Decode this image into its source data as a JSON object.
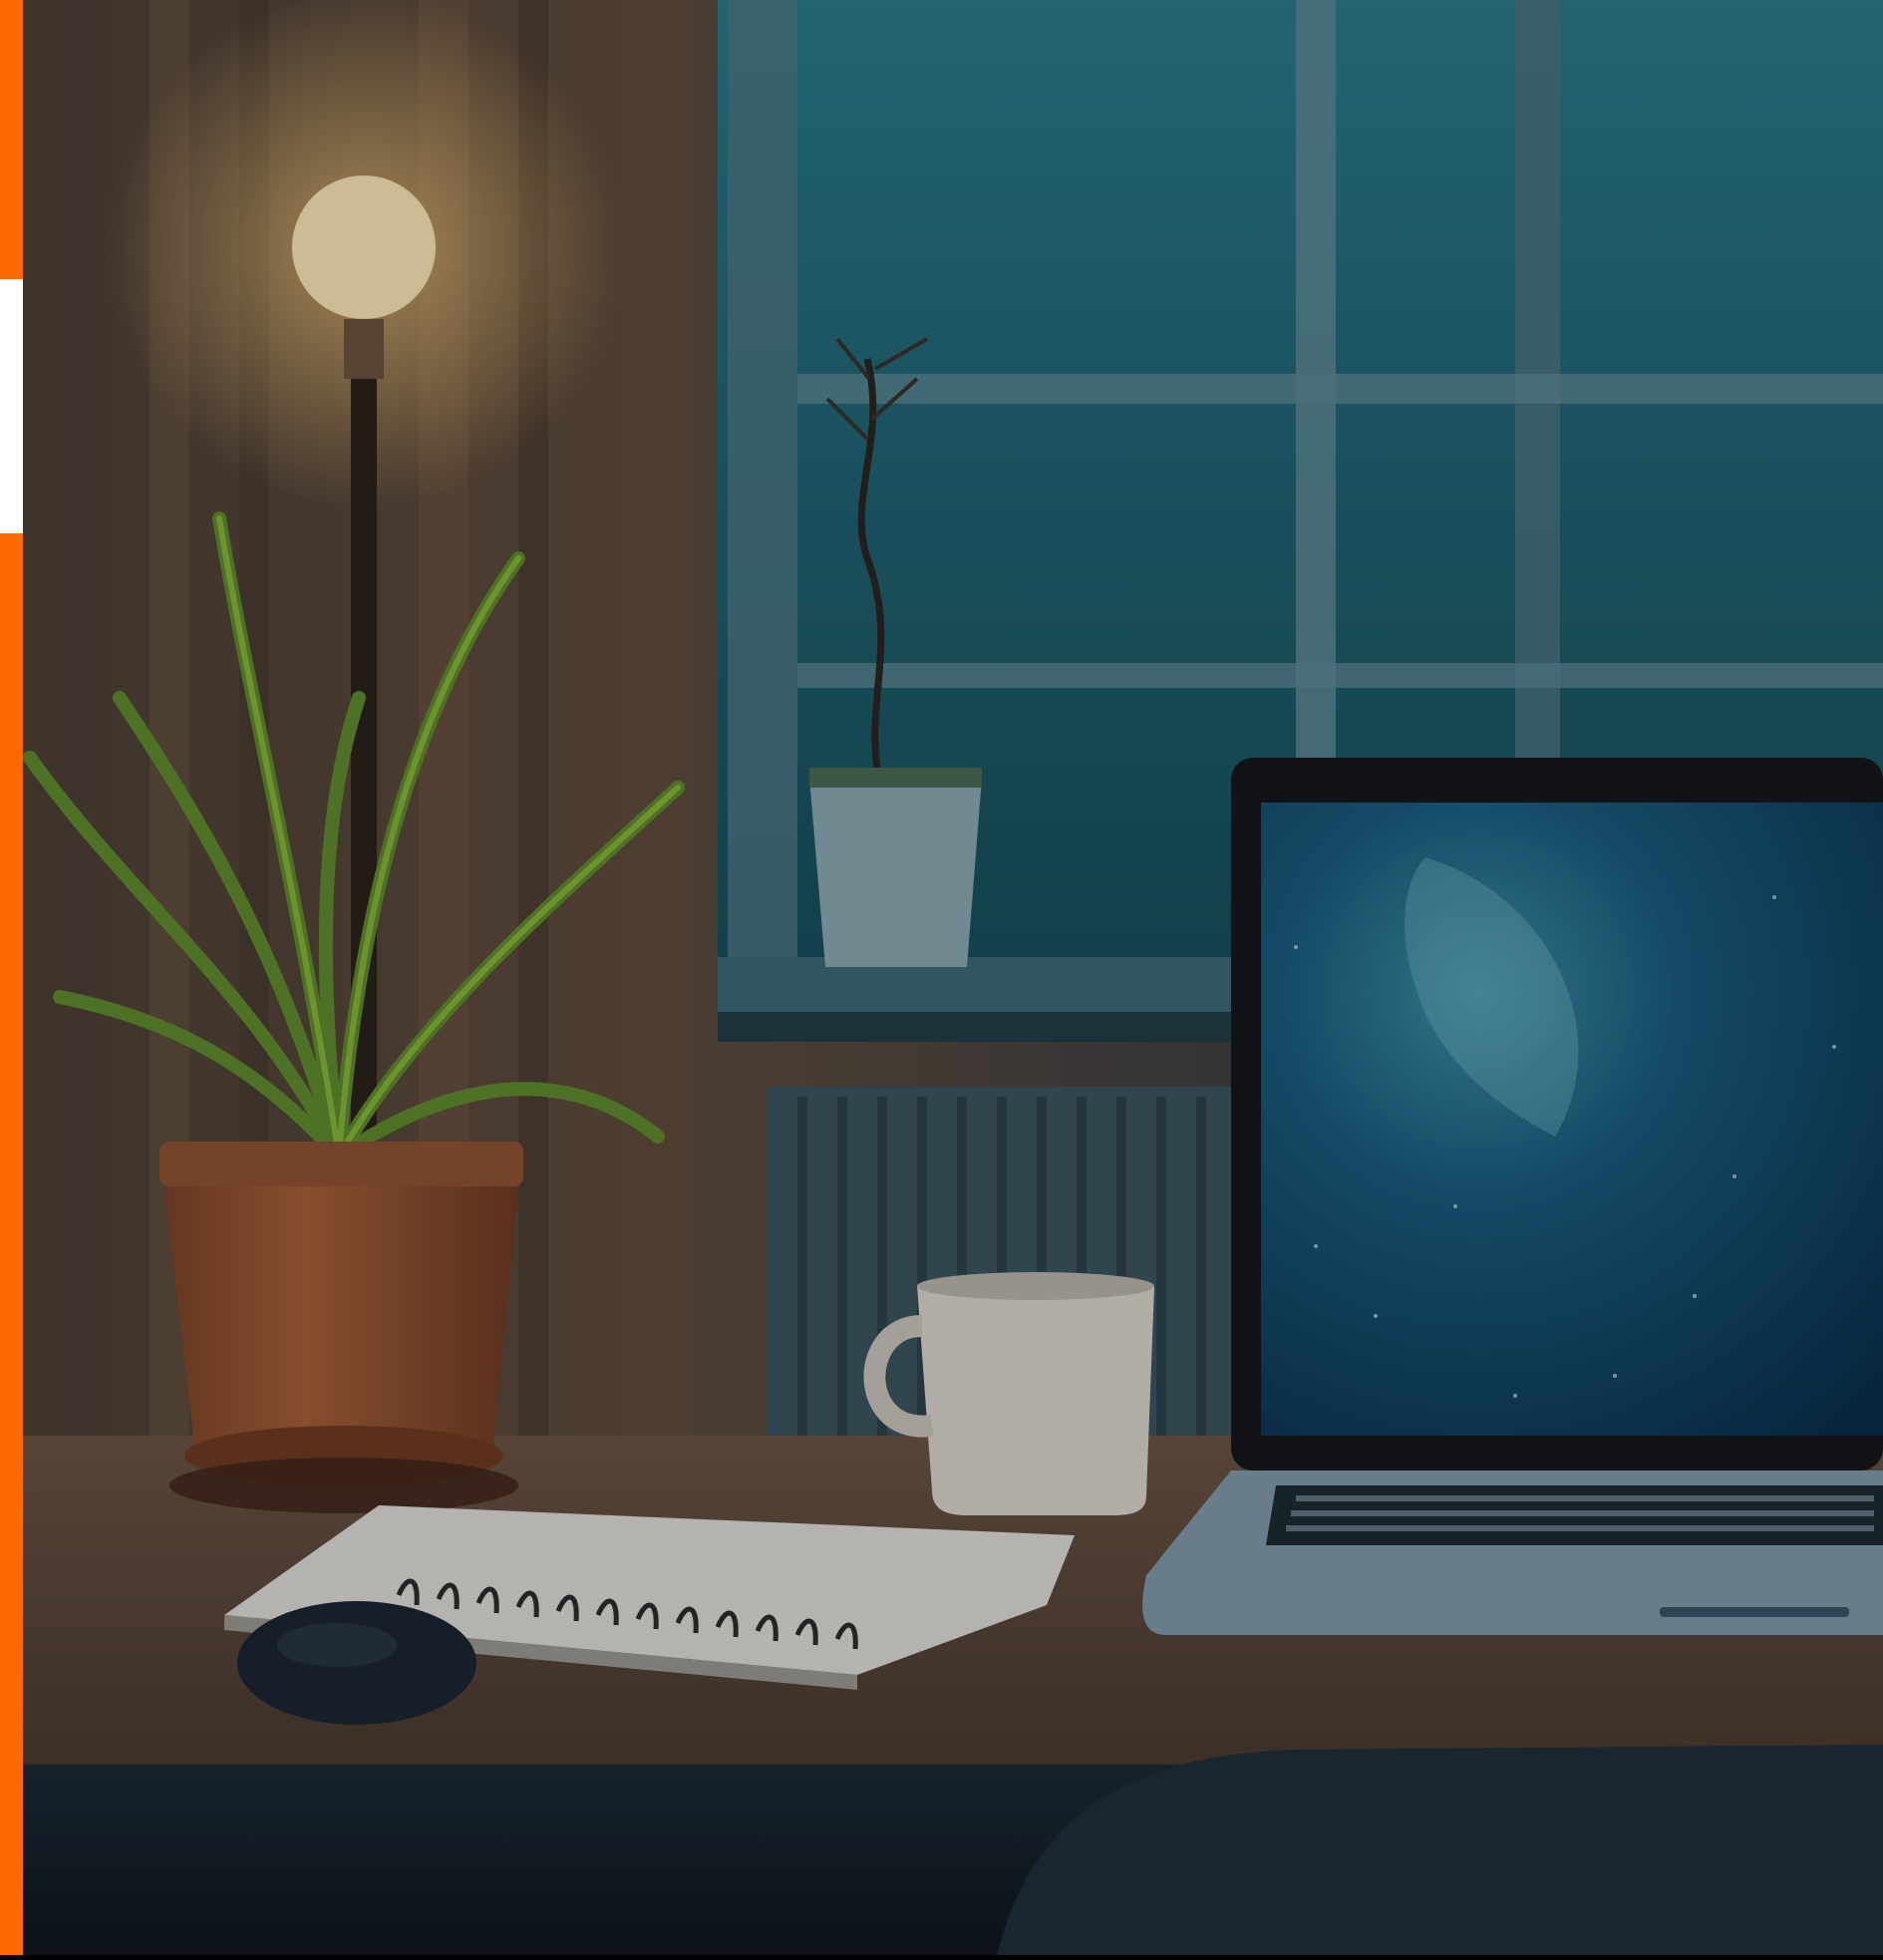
{
  "scene": {
    "subject": "desk-workspace",
    "colors": {
      "accent_orange": "#ff6a00",
      "strip_white": "#ffffff",
      "window_teal": "#1d5e6e",
      "wall_warm": "#5a4a3c",
      "lamp_glow": "#ffe7b0",
      "desk_wood": "#5b4636",
      "screen_blue": "#0e3f5e",
      "pot_terracotta": "#a5603a"
    },
    "icons": {
      "lamp": "lamp-icon",
      "plant": "plant-icon",
      "mug": "mug-icon",
      "laptop": "laptop-icon",
      "notebook": "notebook-icon",
      "mouse": "mouse-icon"
    }
  }
}
